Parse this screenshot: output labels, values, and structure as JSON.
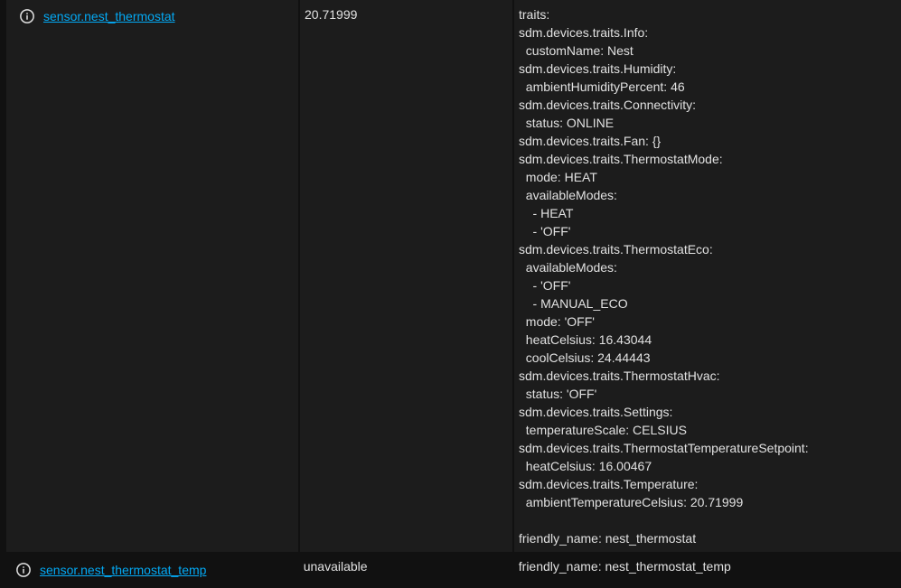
{
  "rows": [
    {
      "entity_id": "sensor.nest_thermostat",
      "state": "20.71999",
      "attributes": [
        "traits:",
        "sdm.devices.traits.Info:",
        "  customName: Nest",
        "sdm.devices.traits.Humidity:",
        "  ambientHumidityPercent: 46",
        "sdm.devices.traits.Connectivity:",
        "  status: ONLINE",
        "sdm.devices.traits.Fan: {}",
        "sdm.devices.traits.ThermostatMode:",
        "  mode: HEAT",
        "  availableModes:",
        "    - HEAT",
        "    - 'OFF'",
        "sdm.devices.traits.ThermostatEco:",
        "  availableModes:",
        "    - 'OFF'",
        "    - MANUAL_ECO",
        "  mode: 'OFF'",
        "  heatCelsius: 16.43044",
        "  coolCelsius: 24.44443",
        "sdm.devices.traits.ThermostatHvac:",
        "  status: 'OFF'",
        "sdm.devices.traits.Settings:",
        "  temperatureScale: CELSIUS",
        "sdm.devices.traits.ThermostatTemperatureSetpoint:",
        "  heatCelsius: 16.00467",
        "sdm.devices.traits.Temperature:",
        "  ambientTemperatureCelsius: 20.71999",
        "",
        "friendly_name: nest_thermostat"
      ]
    },
    {
      "entity_id": "sensor.nest_thermostat_temp",
      "state": "unavailable",
      "attributes": [
        "friendly_name: nest_thermostat_temp"
      ]
    }
  ],
  "colors": {
    "link": "#03a9f4",
    "text": "#e1e1e1",
    "row_bg": "#1c1c1c",
    "page_bg": "#111111"
  },
  "icons": {
    "entity_info": "information-outline-icon"
  }
}
